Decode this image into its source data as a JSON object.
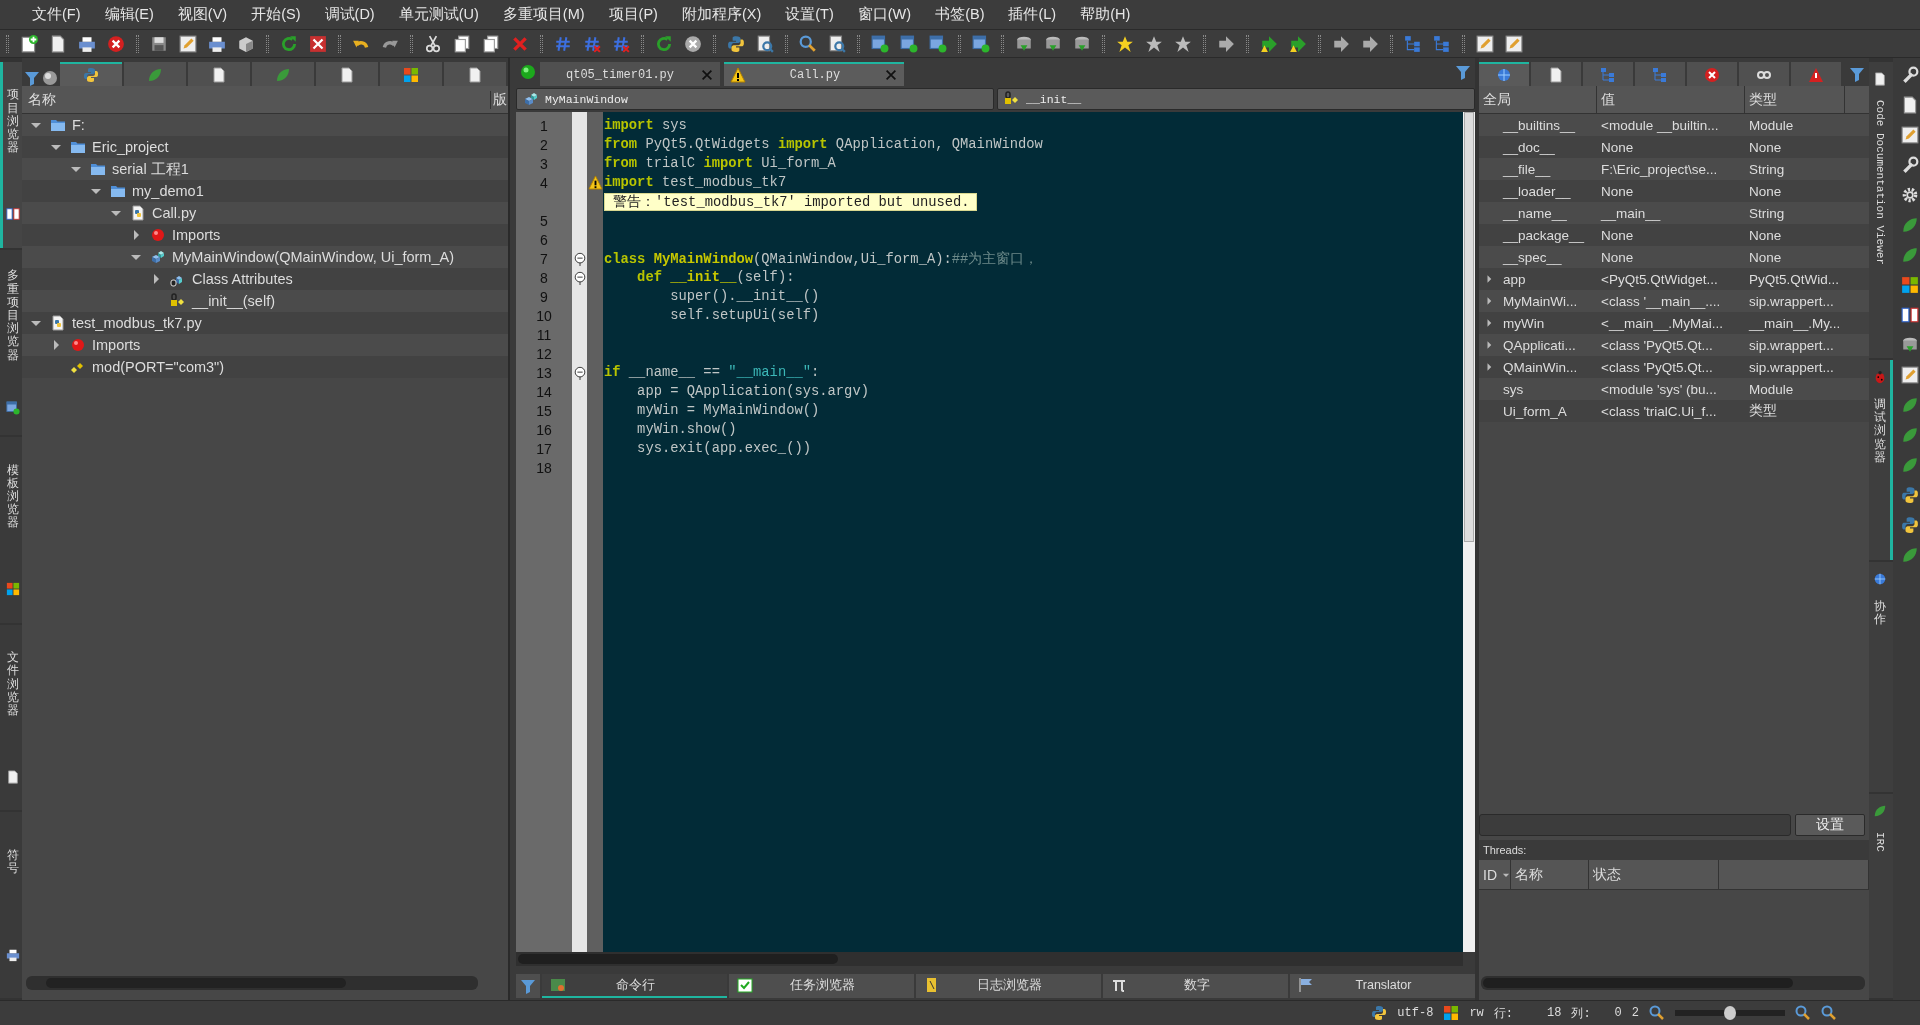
{
  "menu_bar": [
    "文件(F)",
    "编辑(E)",
    "视图(V)",
    "开始(S)",
    "调试(D)",
    "单元测试(U)",
    "多重项目(M)",
    "项目(P)",
    "附加程序(X)",
    "设置(T)",
    "窗口(W)",
    "书签(B)",
    "插件(L)",
    "帮助(H)"
  ],
  "left_tool_tabs": [
    {
      "label": "项目浏览器",
      "selected": true
    },
    {
      "label": "多重项目浏览器",
      "selected": false
    },
    {
      "label": "模板浏览器",
      "selected": false
    },
    {
      "label": "文件浏览器",
      "selected": false
    },
    {
      "label": "符号",
      "selected": false
    }
  ],
  "project_browser": {
    "tabs": [
      {
        "selected": true
      },
      {
        "selected": false
      },
      {
        "selected": false
      },
      {
        "selected": false
      },
      {
        "selected": false
      },
      {
        "selected": false
      },
      {
        "selected": false
      }
    ],
    "column_header": "名称",
    "column_2": "版",
    "tree": [
      {
        "label": "F:",
        "kind": "folder",
        "expanded": true,
        "children": [
          {
            "label": "Eric_project",
            "kind": "folder",
            "expanded": true,
            "children": [
              {
                "label": "serial 工程1",
                "kind": "folder",
                "expanded": true,
                "children": [
                  {
                    "label": "my_demo1",
                    "kind": "folder",
                    "expanded": true,
                    "children": [
                      {
                        "label": "Call.py",
                        "kind": "file",
                        "expanded": true,
                        "children": [
                          {
                            "label": "Imports",
                            "kind": "imports",
                            "expanded": false
                          },
                          {
                            "label": "MyMainWindow(QMainWindow, Ui_form_A)",
                            "kind": "class",
                            "expanded": true,
                            "children": [
                              {
                                "label": "Class Attributes",
                                "kind": "attributes",
                                "expanded": false
                              },
                              {
                                "label": "__init__(self)",
                                "kind": "method"
                              }
                            ]
                          }
                        ]
                      }
                    ]
                  }
                ]
              }
            ]
          }
        ]
      },
      {
        "label": "test_modbus_tk7.py",
        "kind": "file",
        "expanded": true,
        "children": [
          {
            "label": "Imports",
            "kind": "imports",
            "expanded": false
          },
          {
            "label": "mod(PORT=\"com3\")",
            "kind": "function"
          }
        ]
      }
    ]
  },
  "editor": {
    "tabs": [
      {
        "label": "qt05_timer01.py",
        "selected": false,
        "warning": false
      },
      {
        "label": "Call.py",
        "selected": true,
        "warning": true
      }
    ],
    "class_selector": "MyMainWindow",
    "method_selector": "__init__",
    "lines": [
      {
        "number": "1",
        "fold": false,
        "warning": false,
        "segments": [
          {
            "kind": "keyword",
            "text": "import"
          },
          {
            "kind": "plain",
            "text": " sys"
          }
        ]
      },
      {
        "number": "2",
        "fold": false,
        "warning": false,
        "segments": [
          {
            "kind": "keyword",
            "text": "from"
          },
          {
            "kind": "plain",
            "text": " PyQt5.QtWidgets "
          },
          {
            "kind": "keyword",
            "text": "import"
          },
          {
            "kind": "plain",
            "text": " QApplication, QMainWindow"
          }
        ]
      },
      {
        "number": "3",
        "fold": false,
        "warning": false,
        "segments": [
          {
            "kind": "keyword",
            "text": "from"
          },
          {
            "kind": "plain",
            "text": " trialC "
          },
          {
            "kind": "keyword",
            "text": "import"
          },
          {
            "kind": "plain",
            "text": " Ui_form_A"
          }
        ]
      },
      {
        "number": "4",
        "fold": false,
        "warning": true,
        "segments": [
          {
            "kind": "keyword",
            "text": "import"
          },
          {
            "kind": "plain",
            "text": " test_modbus_tk7"
          }
        ],
        "annotation": "警告：'test_modbus_tk7' imported but unused."
      },
      {
        "number": "5",
        "fold": false,
        "warning": false
      },
      {
        "number": "6",
        "fold": false,
        "warning": false
      },
      {
        "number": "7",
        "fold": true,
        "warning": false,
        "segments": [
          {
            "kind": "keyword",
            "text": "class "
          },
          {
            "kind": "classname",
            "text": "MyMainWindow"
          },
          {
            "kind": "plain",
            "text": "(QMainWindow,Ui_form_A):"
          },
          {
            "kind": "comment",
            "text": "##为主窗口，"
          }
        ]
      },
      {
        "number": "8",
        "fold": true,
        "warning": false,
        "segments": [
          {
            "kind": "keyword",
            "text": "    def "
          },
          {
            "kind": "defname",
            "text": "__init__"
          },
          {
            "kind": "plain",
            "text": "(self):"
          }
        ]
      },
      {
        "number": "9",
        "fold": false,
        "warning": false,
        "segments": [
          {
            "kind": "plain",
            "text": "        super().__init__()"
          }
        ]
      },
      {
        "number": "10",
        "fold": false,
        "warning": false,
        "segments": [
          {
            "kind": "plain",
            "text": "        self.setupUi(self)"
          }
        ]
      },
      {
        "number": "11",
        "fold": false,
        "warning": false
      },
      {
        "number": "12",
        "fold": false,
        "warning": false
      },
      {
        "number": "13",
        "fold": true,
        "warning": false,
        "segments": [
          {
            "kind": "keyword",
            "text": "if"
          },
          {
            "kind": "plain",
            "text": " __name__ == "
          },
          {
            "kind": "string",
            "text": "\"__main__\""
          },
          {
            "kind": "plain",
            "text": ":"
          }
        ]
      },
      {
        "number": "14",
        "fold": false,
        "warning": false,
        "segments": [
          {
            "kind": "plain",
            "text": "    app = QApplication(sys.argv)"
          }
        ]
      },
      {
        "number": "15",
        "fold": false,
        "warning": false,
        "segments": [
          {
            "kind": "plain",
            "text": "    myWin = MyMainWindow()"
          }
        ]
      },
      {
        "number": "16",
        "fold": false,
        "warning": false,
        "segments": [
          {
            "kind": "plain",
            "text": "    myWin.show()"
          }
        ]
      },
      {
        "number": "17",
        "fold": false,
        "warning": false,
        "segments": [
          {
            "kind": "plain",
            "text": "    sys.exit(app.exec_())"
          }
        ]
      },
      {
        "number": "18",
        "fold": false,
        "warning": false
      }
    ],
    "bottom_tabs": [
      {
        "label": "命令行",
        "selected": true
      },
      {
        "label": "任务浏览器",
        "selected": false
      },
      {
        "label": "日志浏览器",
        "selected": false
      },
      {
        "label": "数字",
        "selected": false
      },
      {
        "label": "Translator",
        "selected": false
      }
    ]
  },
  "debug_viewer": {
    "tabs": [
      {
        "selected": true
      },
      {
        "selected": false
      },
      {
        "selected": false
      },
      {
        "selected": false
      },
      {
        "selected": false
      },
      {
        "selected": false
      },
      {
        "selected": false
      }
    ],
    "columns": [
      "全局",
      "值",
      "类型"
    ],
    "variables": [
      {
        "name": "__builtins__",
        "value": "<module __builtin...",
        "type": "Module",
        "expandable": false
      },
      {
        "name": "__doc__",
        "value": "None",
        "type": "None",
        "expandable": false
      },
      {
        "name": "__file__",
        "value": "F:\\Eric_project\\se...",
        "type": "String",
        "expandable": false
      },
      {
        "name": "__loader__",
        "value": "None",
        "type": "None",
        "expandable": false
      },
      {
        "name": "__name__",
        "value": "__main__",
        "type": "String",
        "expandable": false
      },
      {
        "name": "__package__",
        "value": "None",
        "type": "None",
        "expandable": false
      },
      {
        "name": "__spec__",
        "value": "None",
        "type": "None",
        "expandable": false
      },
      {
        "name": "app",
        "value": "<PyQt5.QtWidget...",
        "type": "PyQt5.QtWid...",
        "expandable": true
      },
      {
        "name": "MyMainWi...",
        "value": "<class '__main__....",
        "type": "sip.wrappert...",
        "expandable": true
      },
      {
        "name": "myWin",
        "value": "<__main__.MyMai...",
        "type": "__main__.My...",
        "expandable": true
      },
      {
        "name": "QApplicati...",
        "value": "<class 'PyQt5.Qt...",
        "type": "sip.wrappert...",
        "expandable": true
      },
      {
        "name": "QMainWin...",
        "value": "<class 'PyQt5.Qt...",
        "type": "sip.wrappert...",
        "expandable": true
      },
      {
        "name": "sys",
        "value": "<module 'sys' (bu...",
        "type": "Module",
        "expandable": false
      },
      {
        "name": "Ui_form_A",
        "value": "<class 'trialC.Ui_f...",
        "type": "类型",
        "expandable": false
      }
    ],
    "settings_button": "设置",
    "threads_label": "Threads:",
    "thread_columns": [
      "ID",
      "名称",
      "状态"
    ]
  },
  "right_tool_tabs": [
    {
      "label": "Code Documentation Viewer",
      "kind": "rotated",
      "selected": false
    },
    {
      "label": "调试浏览器",
      "kind": "stacked",
      "selected": true
    },
    {
      "label": "协作",
      "kind": "stacked",
      "selected": false
    },
    {
      "label": "IRC",
      "kind": "rotated",
      "selected": false
    }
  ],
  "status_bar": {
    "encoding": "utf-8",
    "mode": "rw",
    "line_label": "行:",
    "line": "18",
    "column_label": "列:",
    "column": "0",
    "zoom": "2",
    "zoom_slider": {
      "level": 0.5
    }
  }
}
